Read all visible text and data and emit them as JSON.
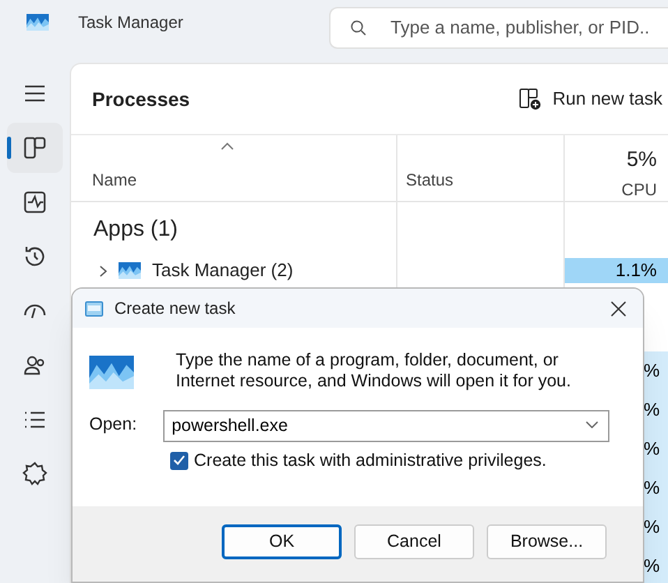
{
  "window": {
    "title": "Task Manager"
  },
  "search": {
    "placeholder": "Type a name, publisher, or PID.."
  },
  "sidebar": {
    "items": [
      {
        "kind": "menu",
        "selected": false
      },
      {
        "kind": "processes",
        "selected": true
      },
      {
        "kind": "performance",
        "selected": false
      },
      {
        "kind": "history",
        "selected": false
      },
      {
        "kind": "startup",
        "selected": false
      },
      {
        "kind": "users",
        "selected": false
      },
      {
        "kind": "details",
        "selected": false
      },
      {
        "kind": "services",
        "selected": false
      }
    ]
  },
  "page": {
    "title": "Processes",
    "action": "Run new task"
  },
  "table": {
    "columns": [
      {
        "label": "Name"
      },
      {
        "label": "Status"
      },
      {
        "label": "CPU",
        "summary": "5%"
      }
    ],
    "group": "Apps (1)",
    "rows": [
      {
        "name": "Task Manager (2)",
        "cpu": "1.1%"
      }
    ],
    "covered_cpu_cells": [
      "%",
      "%",
      "%",
      "%",
      "%",
      "%"
    ]
  },
  "dialog": {
    "title": "Create new task",
    "message": "Type the name of a program, folder, document, or Internet resource, and Windows will open it for you.",
    "open_label": "Open:",
    "open_value": "powershell.exe",
    "admin": {
      "label": "Create this task with administrative privileges.",
      "checked": true
    },
    "buttons": [
      {
        "label": "OK",
        "default": true
      },
      {
        "label": "Cancel",
        "default": false
      },
      {
        "label": "Browse...",
        "default": false
      }
    ]
  }
}
